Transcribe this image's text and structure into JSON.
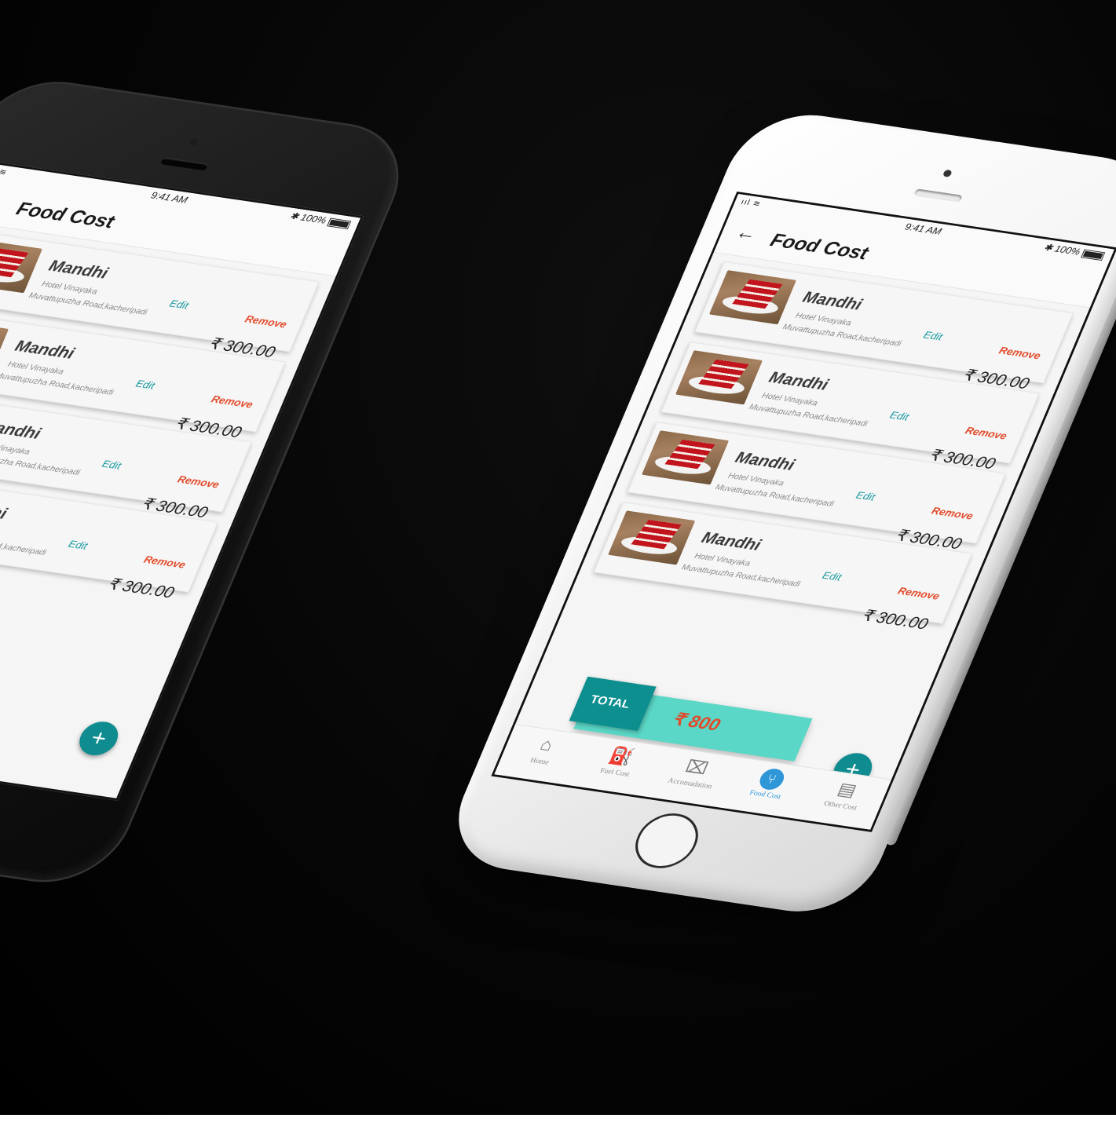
{
  "colors": {
    "accent_teal": "#0d8f90",
    "total_bar": "#5ad7c6",
    "edit": "#1a9aa0",
    "remove": "#e24a2a",
    "active_nav": "#2f96d8"
  },
  "status_bar": {
    "time": "9:41 AM",
    "battery": "100%",
    "signal": "ııl ≋",
    "bluetooth": "✱"
  },
  "header": {
    "back_icon": "back-arrow-icon",
    "title": "Food Cost"
  },
  "food_items": [
    {
      "name": "Mandhi",
      "place": "Hotel Vinayaka",
      "address": "Muvattupuzha Road,kacheripadi",
      "edit": "Edit",
      "remove": "Remove",
      "price": "₹ 300.00"
    },
    {
      "name": "Mandhi",
      "place": "Hotel Vinayaka",
      "address": "Muvattupuzha Road,kacheripadi",
      "edit": "Edit",
      "remove": "Remove",
      "price": "₹ 300.00"
    },
    {
      "name": "Mandhi",
      "place": "Hotel Vinayaka",
      "address": "Muvattupuzha Road,kacheripadi",
      "edit": "Edit",
      "remove": "Remove",
      "price": "₹ 300.00"
    },
    {
      "name": "Mandhi",
      "place": "Hotel Vinayaka",
      "address": "Muvattupuzha Road,kacheripadi",
      "edit": "Edit",
      "remove": "Remove",
      "price": "₹ 300.00"
    }
  ],
  "total": {
    "label": "TOTAL",
    "value": "₹  800"
  },
  "fab": {
    "icon": "+"
  },
  "bottom_nav": [
    {
      "label": "Home",
      "icon": "home-icon",
      "glyph": "⌂"
    },
    {
      "label": "Fuel Cost",
      "icon": "fuel-pump-icon",
      "glyph": "⛽"
    },
    {
      "label": "Accomadation",
      "icon": "accommodation-icon",
      "glyph": "⌧"
    },
    {
      "label": "Food Cost",
      "icon": "food-icon",
      "glyph": "⑂",
      "active": true
    },
    {
      "label": "Other Cost",
      "icon": "clipboard-icon",
      "glyph": "▤"
    }
  ]
}
